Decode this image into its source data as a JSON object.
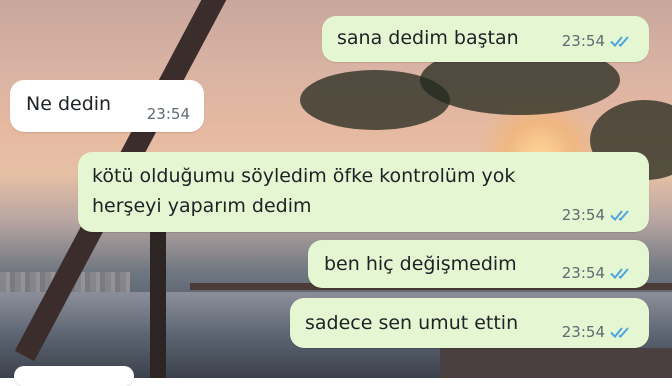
{
  "colors": {
    "outgoing_bubble": "#e4f7d2",
    "incoming_bubble": "#ffffff",
    "read_tick": "#4fa3e0",
    "timestamp": "#5f6b70"
  },
  "messages": [
    {
      "direction": "outgoing",
      "text": "sana dedim baştan",
      "time": "23:54",
      "status": "read"
    },
    {
      "direction": "incoming",
      "text": "Ne dedin",
      "time": "23:54"
    },
    {
      "direction": "outgoing",
      "lines": [
        "kötü olduğumu söyledim öfke kontrolüm yok",
        "herşeyi yaparım dedim"
      ],
      "time": "23:54",
      "status": "read"
    },
    {
      "direction": "outgoing",
      "text": "ben hiç değişmedim",
      "time": "23:54",
      "status": "read"
    },
    {
      "direction": "outgoing",
      "text": "sadece sen umut ettin",
      "time": "23:54",
      "status": "read"
    }
  ]
}
